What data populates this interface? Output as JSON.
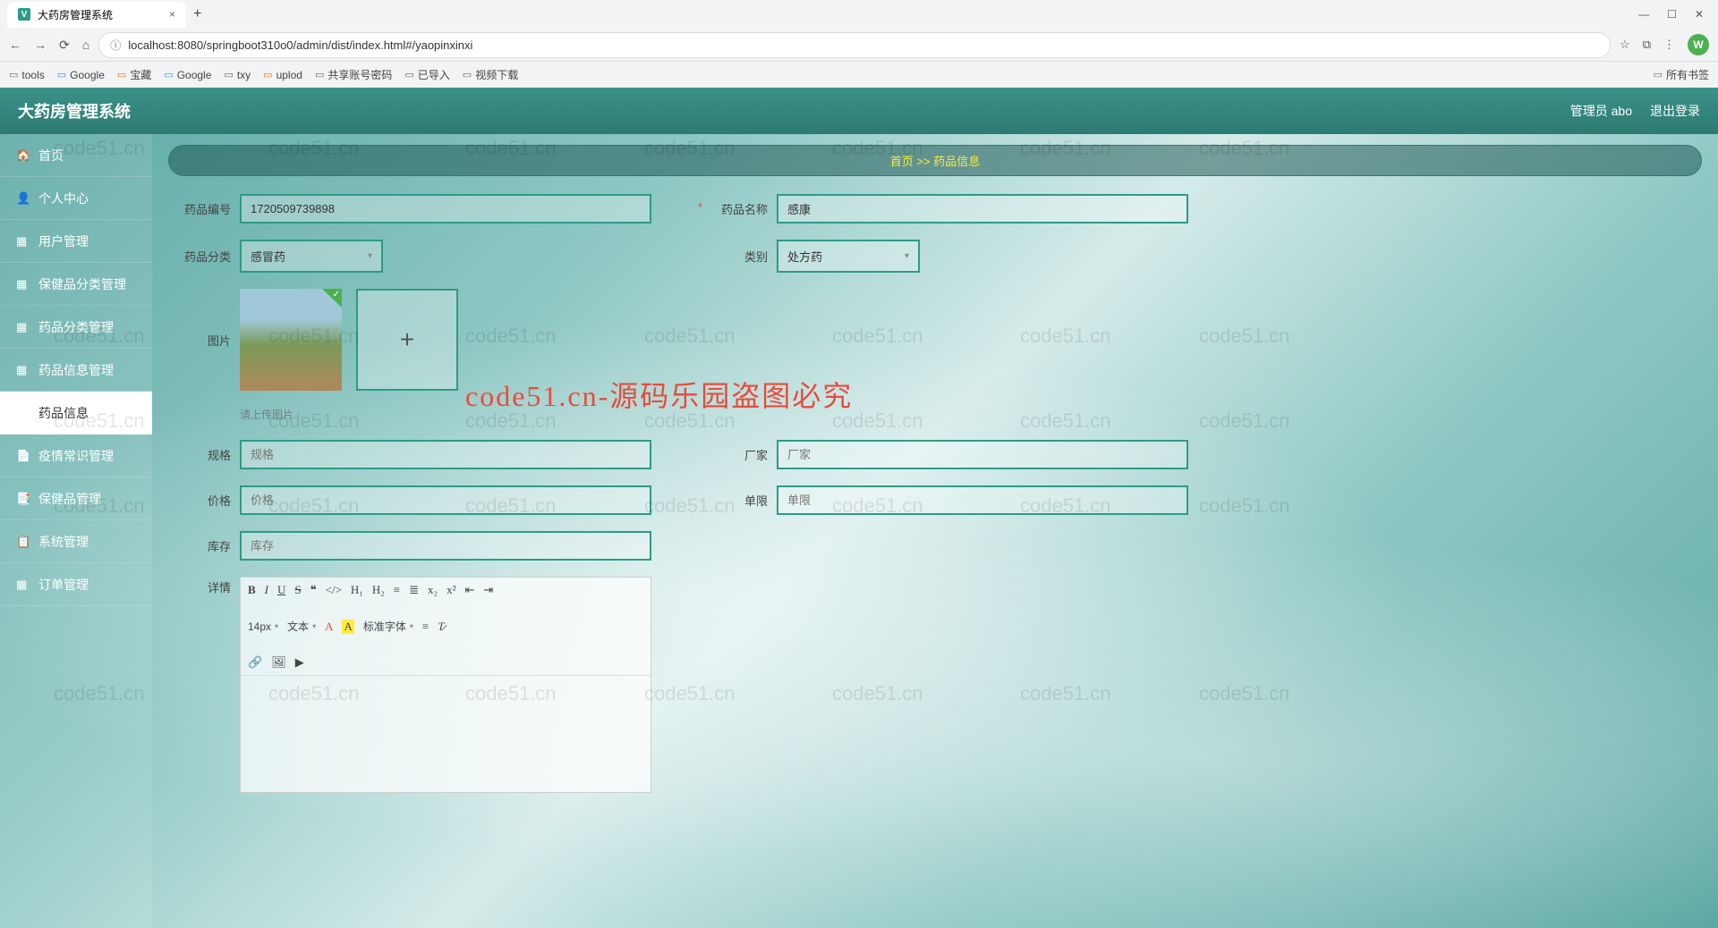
{
  "browser": {
    "tab_title": "大药房管理系统",
    "url": "localhost:8080/springboot310o0/admin/dist/index.html#/yaopinxinxi",
    "avatar_letter": "W"
  },
  "bookmarks": [
    "tools",
    "Google",
    "宝藏",
    "Google",
    "txy",
    "uplod",
    "共享账号密码",
    "已导入",
    "视频下载"
  ],
  "bookmarks_all": "所有书签",
  "header": {
    "title": "大药房管理系统",
    "user": "管理员 abo",
    "logout": "退出登录"
  },
  "sidebar": [
    {
      "icon": "🏠",
      "label": "首页"
    },
    {
      "icon": "👤",
      "label": "个人中心"
    },
    {
      "icon": "▦",
      "label": "用户管理"
    },
    {
      "icon": "▦",
      "label": "保健品分类管理"
    },
    {
      "icon": "▦",
      "label": "药品分类管理"
    },
    {
      "icon": "▦",
      "label": "药品信息管理"
    },
    {
      "icon": "",
      "label": "药品信息",
      "active": true
    },
    {
      "icon": "📄",
      "label": "疫情常识管理"
    },
    {
      "icon": "📑",
      "label": "保健品管理"
    },
    {
      "icon": "📋",
      "label": "系统管理"
    },
    {
      "icon": "▦",
      "label": "订单管理"
    }
  ],
  "breadcrumb": {
    "home": "首页",
    "sep": ">>",
    "current": "药品信息"
  },
  "form": {
    "code_label": "药品编号",
    "code_value": "1720509739898",
    "name_label": "药品名称",
    "name_value": "感康",
    "class_label": "药品分类",
    "class_value": "感冒药",
    "type_label": "类别",
    "type_value": "处方药",
    "image_label": "图片",
    "upload_hint": "请上传图片",
    "spec_label": "规格",
    "spec_placeholder": "规格",
    "maker_label": "厂家",
    "maker_placeholder": "厂家",
    "price_label": "价格",
    "price_placeholder": "价格",
    "unit_label": "单限",
    "unit_placeholder": "单限",
    "stock_label": "库存",
    "stock_placeholder": "库存",
    "detail_label": "详情"
  },
  "editor": {
    "font_size": "14px",
    "text_label": "文本",
    "std_font": "标准字体"
  },
  "watermarks": {
    "text": "code51.cn",
    "red": "code51.cn-源码乐园盗图必究"
  }
}
